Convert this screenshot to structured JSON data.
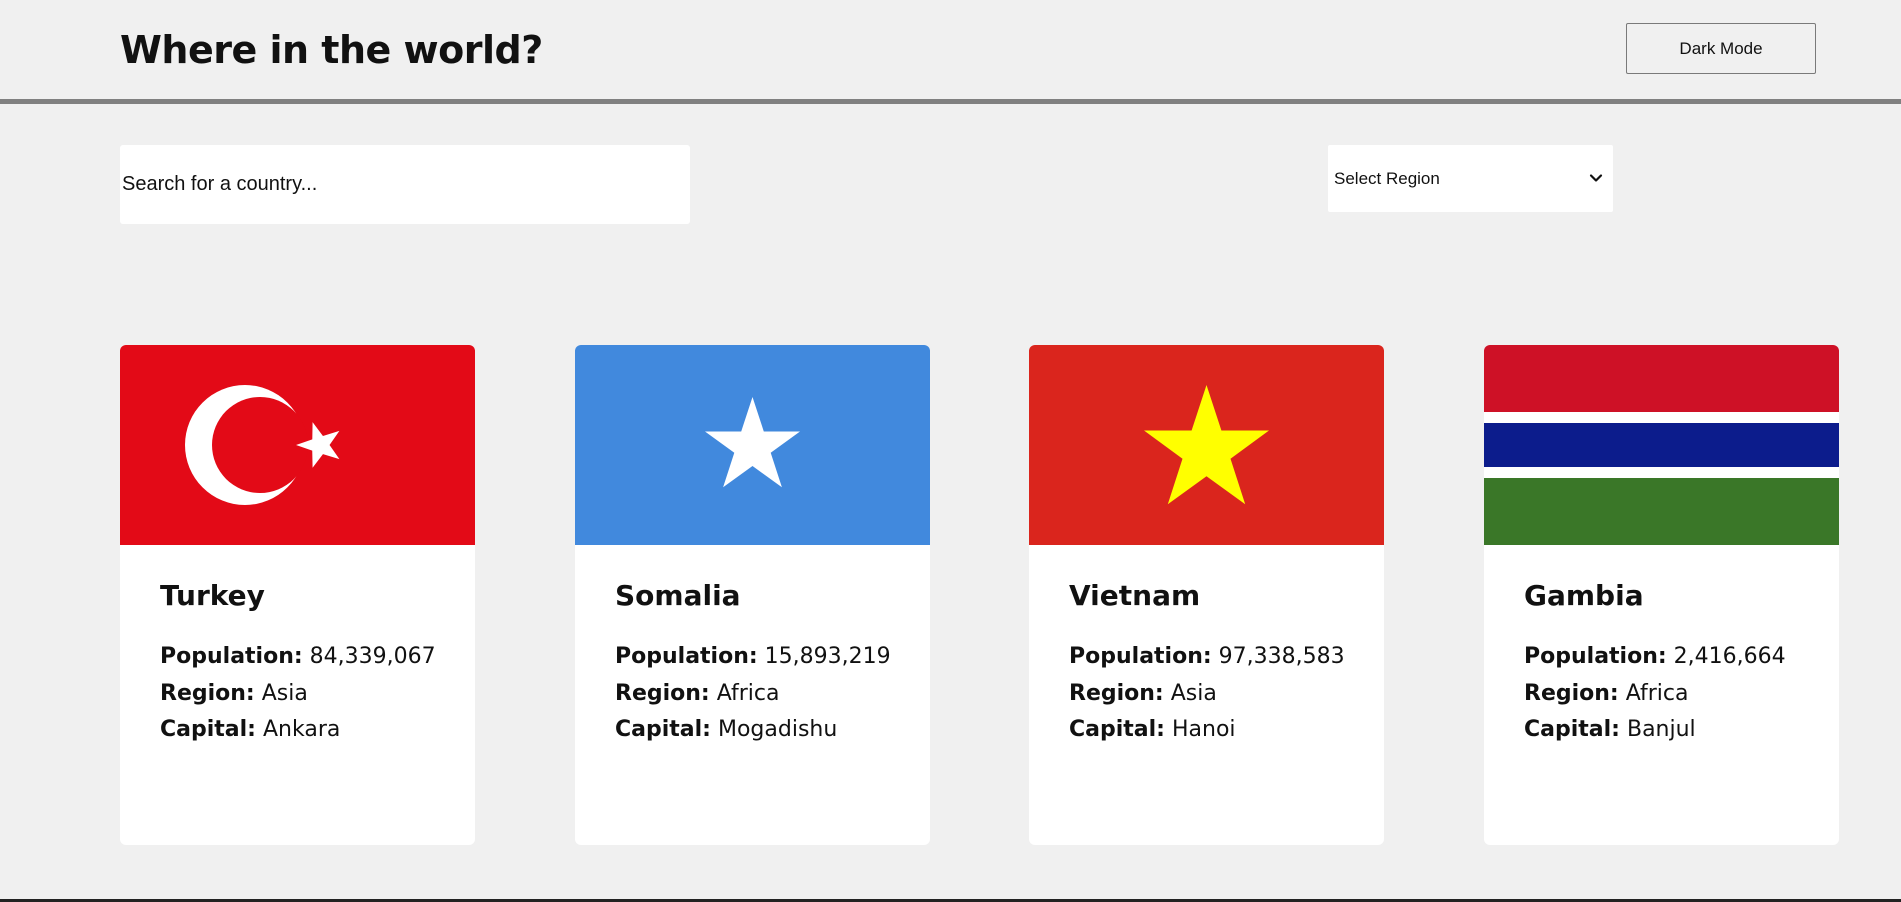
{
  "header": {
    "title": "Where in the world?",
    "dark_mode_label": "Dark Mode"
  },
  "search": {
    "placeholder": "Search for a country..."
  },
  "filter": {
    "selected": "Select Region",
    "icon": "chevron-down-icon"
  },
  "labels": {
    "population": "Population:",
    "region": "Region:",
    "capital": "Capital:"
  },
  "countries": [
    {
      "name": "Turkey",
      "population": "84,339,067",
      "region": "Asia",
      "capital": "Ankara",
      "flag_icon": "turkey-flag-icon",
      "flag_colors": [
        "#E30A17",
        "#FFFFFF"
      ]
    },
    {
      "name": "Somalia",
      "population": "15,893,219",
      "region": "Africa",
      "capital": "Mogadishu",
      "flag_icon": "somalia-flag-icon",
      "flag_colors": [
        "#4189DD",
        "#FFFFFF"
      ]
    },
    {
      "name": "Vietnam",
      "population": "97,338,583",
      "region": "Asia",
      "capital": "Hanoi",
      "flag_icon": "vietnam-flag-icon",
      "flag_colors": [
        "#DA251D",
        "#FFFF00"
      ]
    },
    {
      "name": "Gambia",
      "population": "2,416,664",
      "region": "Africa",
      "capital": "Banjul",
      "flag_icon": "gambia-flag-icon",
      "flag_colors": [
        "#CE1126",
        "#FFFFFF",
        "#0C1C8C",
        "#3A7728"
      ]
    }
  ],
  "colors": {
    "page_background": "#F0F0F0",
    "card_background": "#FFFFFF",
    "divider": "#808080"
  }
}
